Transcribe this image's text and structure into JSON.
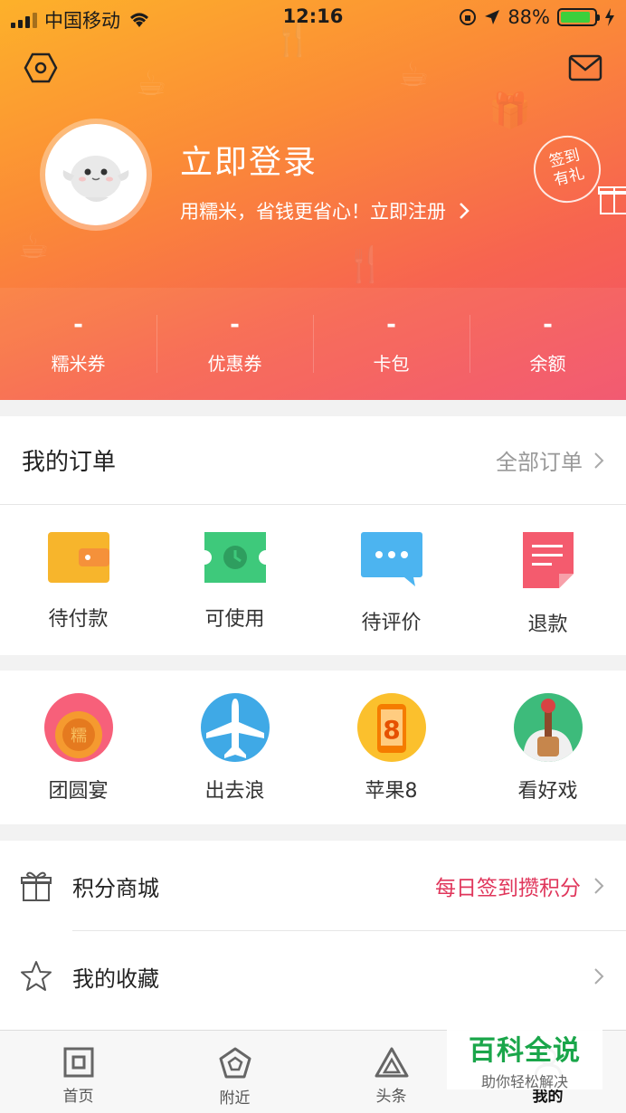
{
  "status_bar": {
    "carrier": "中国移动",
    "time": "12:16",
    "battery_percent": "88%",
    "battery_level": 0.88
  },
  "header": {
    "login_title": "立即登录",
    "login_subtitle": "用糯米，省钱更省心！立即注册",
    "signin_badge_line1": "签到",
    "signin_badge_line2": "有礼",
    "settings_icon": "hexagon-settings-icon",
    "message_icon": "envelope-icon"
  },
  "stats": [
    {
      "value": "-",
      "label": "糯米券"
    },
    {
      "value": "-",
      "label": "优惠券"
    },
    {
      "value": "-",
      "label": "卡包"
    },
    {
      "value": "-",
      "label": "余额"
    }
  ],
  "orders": {
    "title": "我的订单",
    "all_label": "全部订单",
    "items": [
      {
        "label": "待付款",
        "icon": "wallet-icon",
        "color": "#f7b52c"
      },
      {
        "label": "可使用",
        "icon": "ticket-clock-icon",
        "color": "#3ec97b"
      },
      {
        "label": "待评价",
        "icon": "chat-bubble-icon",
        "color": "#4cb4f0"
      },
      {
        "label": "退款",
        "icon": "document-icon",
        "color": "#f45b6e"
      }
    ]
  },
  "promos": [
    {
      "label": "团圆宴",
      "icon": "mooncake-icon"
    },
    {
      "label": "出去浪",
      "icon": "airplane-icon"
    },
    {
      "label": "苹果8",
      "icon": "phone-8-icon"
    },
    {
      "label": "看好戏",
      "icon": "opera-icon"
    }
  ],
  "list": [
    {
      "label": "积分商城",
      "extra": "每日签到攒积分",
      "icon": "gift-icon"
    },
    {
      "label": "我的收藏",
      "extra": "",
      "icon": "star-icon"
    }
  ],
  "tabs": [
    {
      "label": "首页",
      "icon": "home-square-icon"
    },
    {
      "label": "附近",
      "icon": "pentagon-location-icon"
    },
    {
      "label": "头条",
      "icon": "triangle-news-icon"
    },
    {
      "label": "我的",
      "icon": "profile-icon",
      "active": true
    }
  ],
  "watermark": {
    "title": "百科全说",
    "subtitle": "助你轻松解决"
  }
}
